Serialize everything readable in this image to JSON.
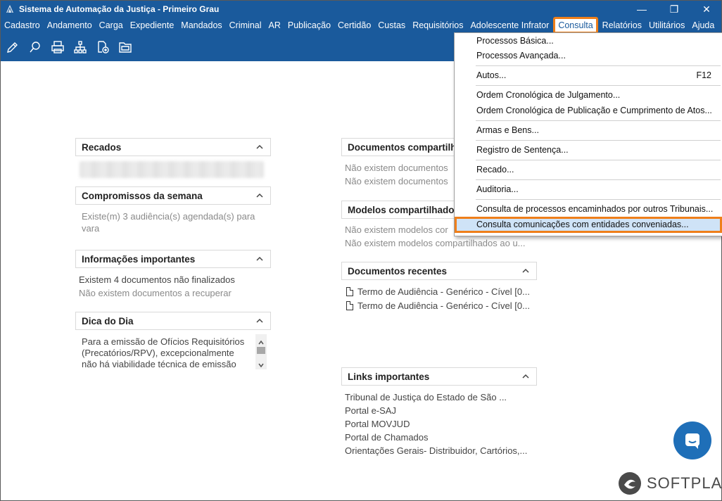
{
  "window": {
    "title": "Sistema de Automação da Justiça - Primeiro Grau",
    "minimize": "—",
    "maximize": "❐",
    "close": "✕"
  },
  "menubar": {
    "items": [
      "Cadastro",
      "Andamento",
      "Carga",
      "Expediente",
      "Mandados",
      "Criminal",
      "AR",
      "Publicação",
      "Certidão",
      "Custas",
      "Requisitórios",
      "Adolescente Infrator",
      "Consulta",
      "Relatórios",
      "Utilitários",
      "Ajuda"
    ],
    "active": "Consulta"
  },
  "toolbar": {
    "icons": [
      "edit-icon",
      "search-document-icon",
      "printer-icon",
      "hierarchy-icon",
      "add-document-icon",
      "folder-icon"
    ]
  },
  "panels": {
    "recados": {
      "title": "Recados"
    },
    "compromissos": {
      "title": "Compromissos da semana",
      "line1": "Existe(m) 3 audiência(s) agendada(s) para",
      "line2": "vara"
    },
    "informacoes": {
      "title": "Informações importantes",
      "line1": "Existem 4 documentos não finalizados",
      "line2": "Não existem documentos a recuperar"
    },
    "dica": {
      "title": "Dica do Dia",
      "line1": "Para a emissão de Ofícios Requisitórios",
      "line2": "(Precatórios/RPV), excepcionalmente",
      "line3": "não há viabilidade técnica de emissão"
    },
    "documentos_compartilhados": {
      "title": "Documentos compartilha",
      "line1": "Não existem documentos",
      "line2": "Não existem documentos"
    },
    "modelos": {
      "title": "Modelos compartilhados",
      "line1": "Não existem modelos cor",
      "line2": "Não existem modelos compartilhados ao u..."
    },
    "recentes": {
      "title": "Documentos recentes",
      "items": [
        "Termo de Audiência - Genérico - Cível [0...",
        "Termo de Audiência - Genérico - Cível [0..."
      ]
    },
    "links": {
      "title": "Links importantes",
      "items": [
        "Tribunal de Justiça do Estado de São ...",
        "Portal e-SAJ",
        "Portal MOVJUD",
        "Portal de Chamados",
        "Orientações Gerais- Distribuidor, Cartórios,..."
      ]
    }
  },
  "consulta_menu": {
    "items": [
      {
        "label": "Processos Básica...",
        "shortcut": ""
      },
      {
        "label": "Processos Avançada...",
        "shortcut": ""
      },
      {
        "label": "Autos...",
        "shortcut": "F12"
      },
      {
        "label": "Ordem Cronológica de Julgamento...",
        "shortcut": ""
      },
      {
        "label": "Ordem Cronológica de Publicação e Cumprimento de Atos...",
        "shortcut": ""
      },
      {
        "label": "Armas e Bens...",
        "shortcut": ""
      },
      {
        "label": "Registro de Sentença...",
        "shortcut": ""
      },
      {
        "label": "Recado...",
        "shortcut": ""
      },
      {
        "label": "Auditoria...",
        "shortcut": ""
      },
      {
        "label": "Consulta de processos encaminhados por outros Tribunais...",
        "shortcut": ""
      },
      {
        "label": "Consulta comunicações com entidades conveniadas...",
        "shortcut": ""
      }
    ],
    "highlighted": "Consulta comunicações com entidades conveniadas..."
  },
  "branding": {
    "logo_text": "SOFTPLAN"
  },
  "colors": {
    "titlebar": "#1a5a9c",
    "highlight_outline": "#ef7f1a",
    "chat": "#1f6fb8"
  }
}
